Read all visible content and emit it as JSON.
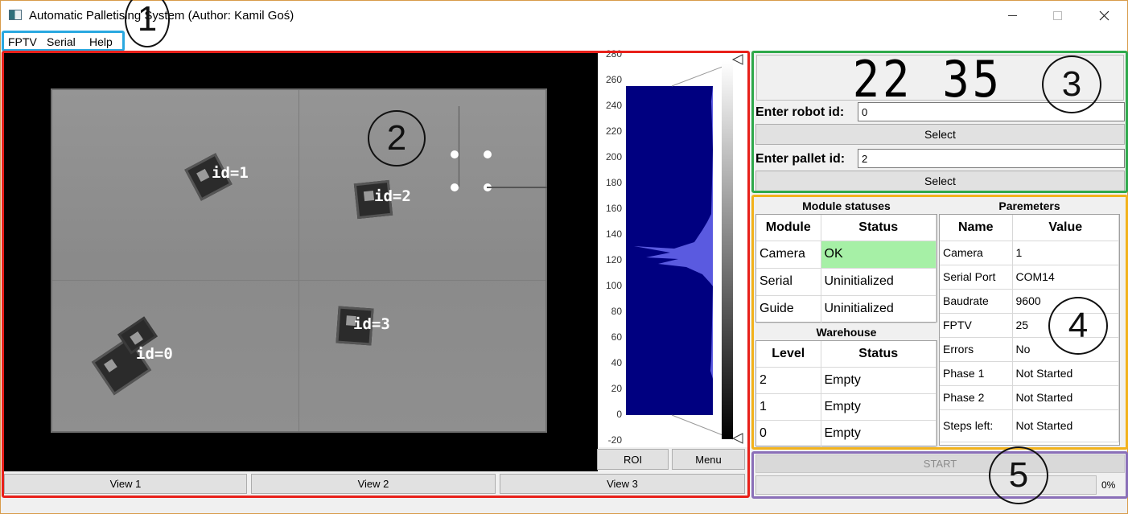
{
  "window": {
    "title": "Automatic Palletising System (Author: Kamil Goś)"
  },
  "menu": [
    "FPTV",
    "Serial",
    "Help"
  ],
  "annotations": [
    "1",
    "2",
    "3",
    "4",
    "5"
  ],
  "camera": {
    "markers": [
      "id=1",
      "id=2",
      "id=3",
      "id=0"
    ]
  },
  "histogram": {
    "ticks": [
      "280",
      "260",
      "240",
      "220",
      "200",
      "180",
      "160",
      "140",
      "120",
      "100",
      "80",
      "60",
      "40",
      "20",
      "0",
      "-20"
    ],
    "roi_label": "ROI",
    "menu_label": "Menu"
  },
  "views": [
    "View 1",
    "View 2",
    "View 3"
  ],
  "control": {
    "clock": "22 35",
    "robot_label": "Enter robot id:",
    "robot_value": "0",
    "select_label": "Select",
    "pallet_label": "Enter pallet id:",
    "pallet_value": "2"
  },
  "modules": {
    "title": "Module statuses",
    "headers": [
      "Module",
      "Status"
    ],
    "rows": [
      {
        "module": "Camera",
        "status": "OK"
      },
      {
        "module": "Serial",
        "status": "Uninitialized"
      },
      {
        "module": "Guide",
        "status": "Uninitialized"
      }
    ]
  },
  "warehouse": {
    "title": "Warehouse",
    "headers": [
      "Level",
      "Status"
    ],
    "rows": [
      {
        "level": "2",
        "status": "Empty"
      },
      {
        "level": "1",
        "status": "Empty"
      },
      {
        "level": "0",
        "status": "Empty"
      }
    ]
  },
  "parameters": {
    "title": "Paremeters",
    "headers": [
      "Name",
      "Value"
    ],
    "rows": [
      {
        "name": "Camera",
        "value": "1"
      },
      {
        "name": "Serial Port",
        "value": "COM14"
      },
      {
        "name": "Baudrate",
        "value": "9600"
      },
      {
        "name": "FPTV",
        "value": "25"
      },
      {
        "name": "Errors",
        "value": "No"
      },
      {
        "name": "Phase 1",
        "value": "Not Started"
      },
      {
        "name": "Phase 2",
        "value": "Not Started"
      },
      {
        "name": "Steps left:",
        "value": "Not Started"
      }
    ]
  },
  "run": {
    "start_label": "START",
    "progress": 0,
    "progress_text": "0%"
  }
}
